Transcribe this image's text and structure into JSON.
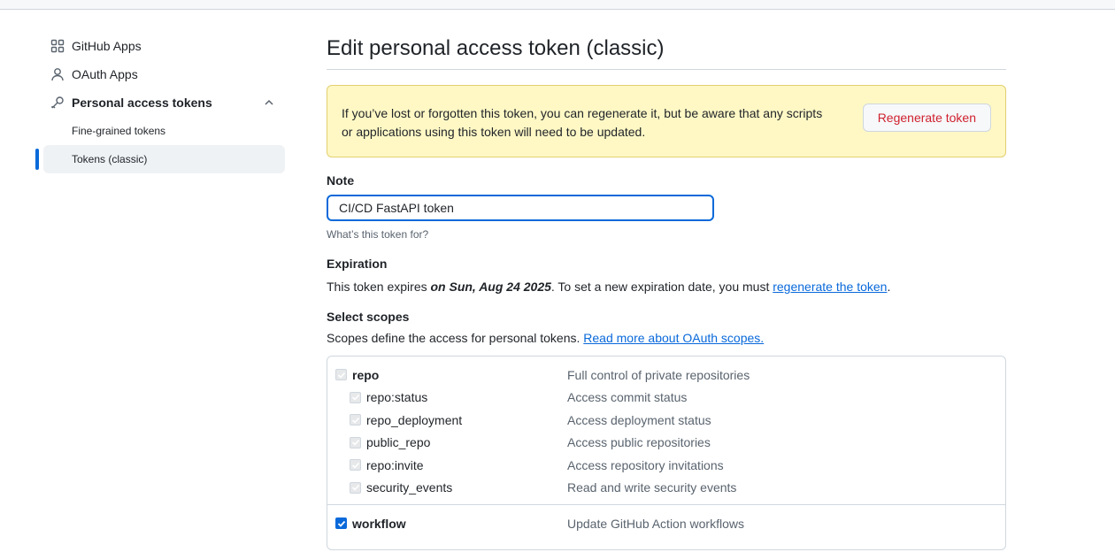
{
  "sidebar": {
    "items": [
      {
        "label": "GitHub Apps",
        "icon": "apps-icon"
      },
      {
        "label": "OAuth Apps",
        "icon": "person-icon"
      },
      {
        "label": "Personal access tokens",
        "icon": "key-icon"
      }
    ],
    "subitems": [
      {
        "label": "Fine-grained tokens"
      },
      {
        "label": "Tokens (classic)",
        "active": true
      }
    ]
  },
  "main": {
    "title": "Edit personal access token (classic)",
    "flash": {
      "line1": "If you’ve lost or forgotten this token, you can regenerate it, but be aware that any scripts",
      "line2": "or applications using this token will need to be updated.",
      "button": "Regenerate token"
    },
    "note": {
      "label": "Note",
      "value": "CI/CD FastAPI token",
      "hint": "What’s this token for?"
    },
    "expiration": {
      "label": "Expiration",
      "prefix": "This token expires ",
      "date": "on Sun, Aug 24 2025",
      "middle": ". To set a new expiration date, you must ",
      "link": "regenerate the token",
      "suffix": "."
    },
    "scopes": {
      "label": "Select scopes",
      "desc": "Scopes define the access for personal tokens. ",
      "link": "Read more about OAuth scopes.",
      "groups": [
        {
          "name": "repo",
          "desc": "Full control of private repositories",
          "children": [
            {
              "name": "repo:status",
              "desc": "Access commit status"
            },
            {
              "name": "repo_deployment",
              "desc": "Access deployment status"
            },
            {
              "name": "public_repo",
              "desc": "Access public repositories"
            },
            {
              "name": "repo:invite",
              "desc": "Access repository invitations"
            },
            {
              "name": "security_events",
              "desc": "Read and write security events"
            }
          ]
        },
        {
          "name": "workflow",
          "desc": "Update GitHub Action workflows",
          "checked": true
        }
      ]
    }
  },
  "colors": {
    "accent": "#0969da",
    "danger": "#cf222e",
    "flash_bg": "#fff8c5"
  }
}
